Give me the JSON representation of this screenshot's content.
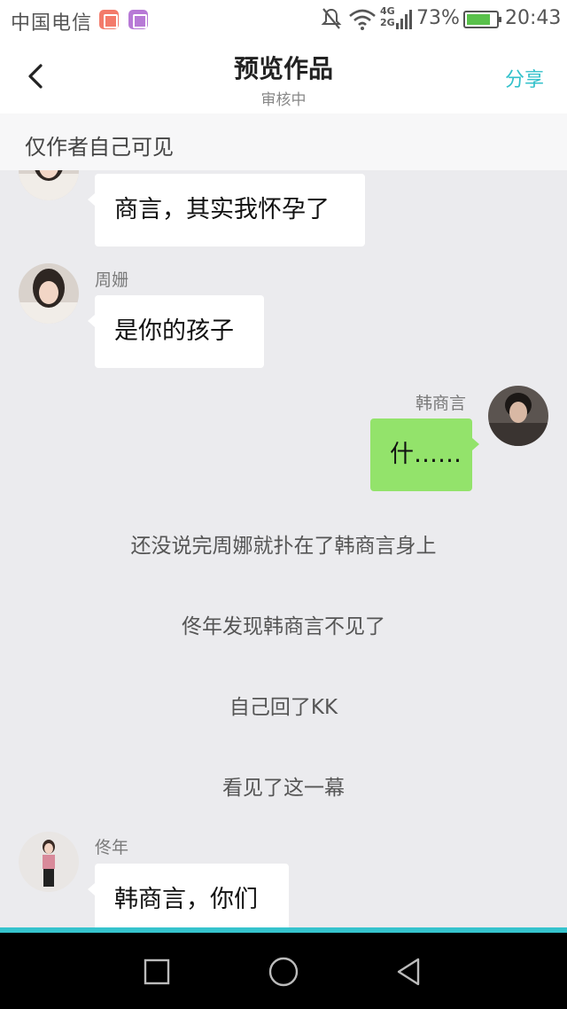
{
  "status_bar": {
    "carrier": "中国电信",
    "network": "4G\n2G",
    "battery": "73%",
    "time": "20:43",
    "battery_color": "#59c14b"
  },
  "header": {
    "title": "预览作品",
    "subtitle": "审核中",
    "share_label": "分享",
    "back_icon": "chevron-left-icon",
    "accent_color": "#33c1cb"
  },
  "notice": "仅作者自己可见",
  "chat": {
    "messages": [
      {
        "side": "left",
        "sender": "",
        "text": "商言，其实我怀孕了",
        "avatar": "zhou-shan-avatar"
      },
      {
        "side": "left",
        "sender": "周姗",
        "text": "是你的孩子",
        "avatar": "zhou-shan-avatar"
      },
      {
        "side": "right",
        "sender": "韩商言",
        "text": "什……",
        "avatar": "han-shangyan-avatar"
      },
      {
        "side": "left",
        "sender": "佟年",
        "text": "韩商言，你们",
        "avatar": "tong-nian-avatar"
      }
    ],
    "narration": [
      "还没说完周娜就扑在了韩商言身上",
      "佟年发现韩商言不见了",
      "自己回了KK",
      "看见了这一幕"
    ],
    "bubble_colors": {
      "left": "#ffffff",
      "right": "#93e36b"
    }
  },
  "nav": {
    "recent_icon": "square-icon",
    "home_icon": "circle-icon",
    "back_icon": "triangle-back-icon"
  }
}
